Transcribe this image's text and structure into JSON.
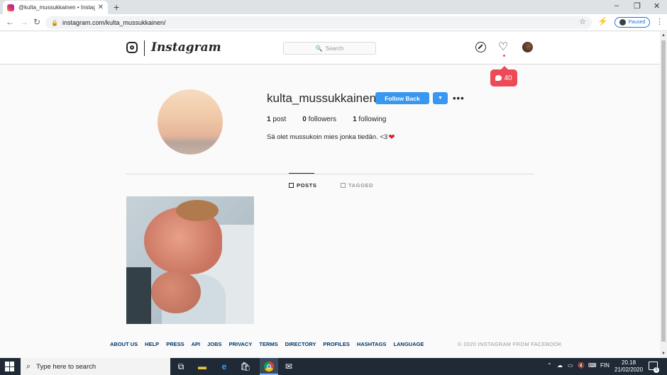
{
  "browser": {
    "tab_title": "@kulta_mussukkainen • Instagram",
    "tab_close": "✕",
    "new_tab": "+",
    "url": "instagram.com/kulta_mussukkainen/",
    "profile_status": "Paused",
    "window_controls": [
      "–",
      "❐",
      "✕"
    ]
  },
  "instagram": {
    "wordmark": "Instagram",
    "search_placeholder": "Search",
    "notification_count": "40",
    "profile": {
      "username": "kulta_mussukkainen",
      "follow_back_label": "Follow Back",
      "dropdown_label": "▼",
      "more_label": "•••",
      "posts_count": "1",
      "posts_label": "post",
      "followers_count": "0",
      "followers_label": "followers",
      "following_count": "1",
      "following_label": "following",
      "bio": "Sä olet mussukoin mies jonka tiedän. <3",
      "bio_emoji": "❤"
    },
    "tabs": [
      {
        "label": "POSTS",
        "active": true
      },
      {
        "label": "TAGGED",
        "active": false
      }
    ],
    "footer_links": [
      "ABOUT US",
      "HELP",
      "PRESS",
      "API",
      "JOBS",
      "PRIVACY",
      "TERMS",
      "DIRECTORY",
      "PROFILES",
      "HASHTAGS",
      "LANGUAGE"
    ],
    "copyright": "© 2020 INSTAGRAM FROM FACEBOOK"
  },
  "taskbar": {
    "search_placeholder": "Type here to search",
    "language": "FIN",
    "time": "20.18",
    "date": "21/02/2020",
    "notification_count": "5"
  },
  "colors": {
    "follow_button": "#3897f0",
    "notification_badge": "#ed4956",
    "taskbar": "#1f2a36"
  }
}
